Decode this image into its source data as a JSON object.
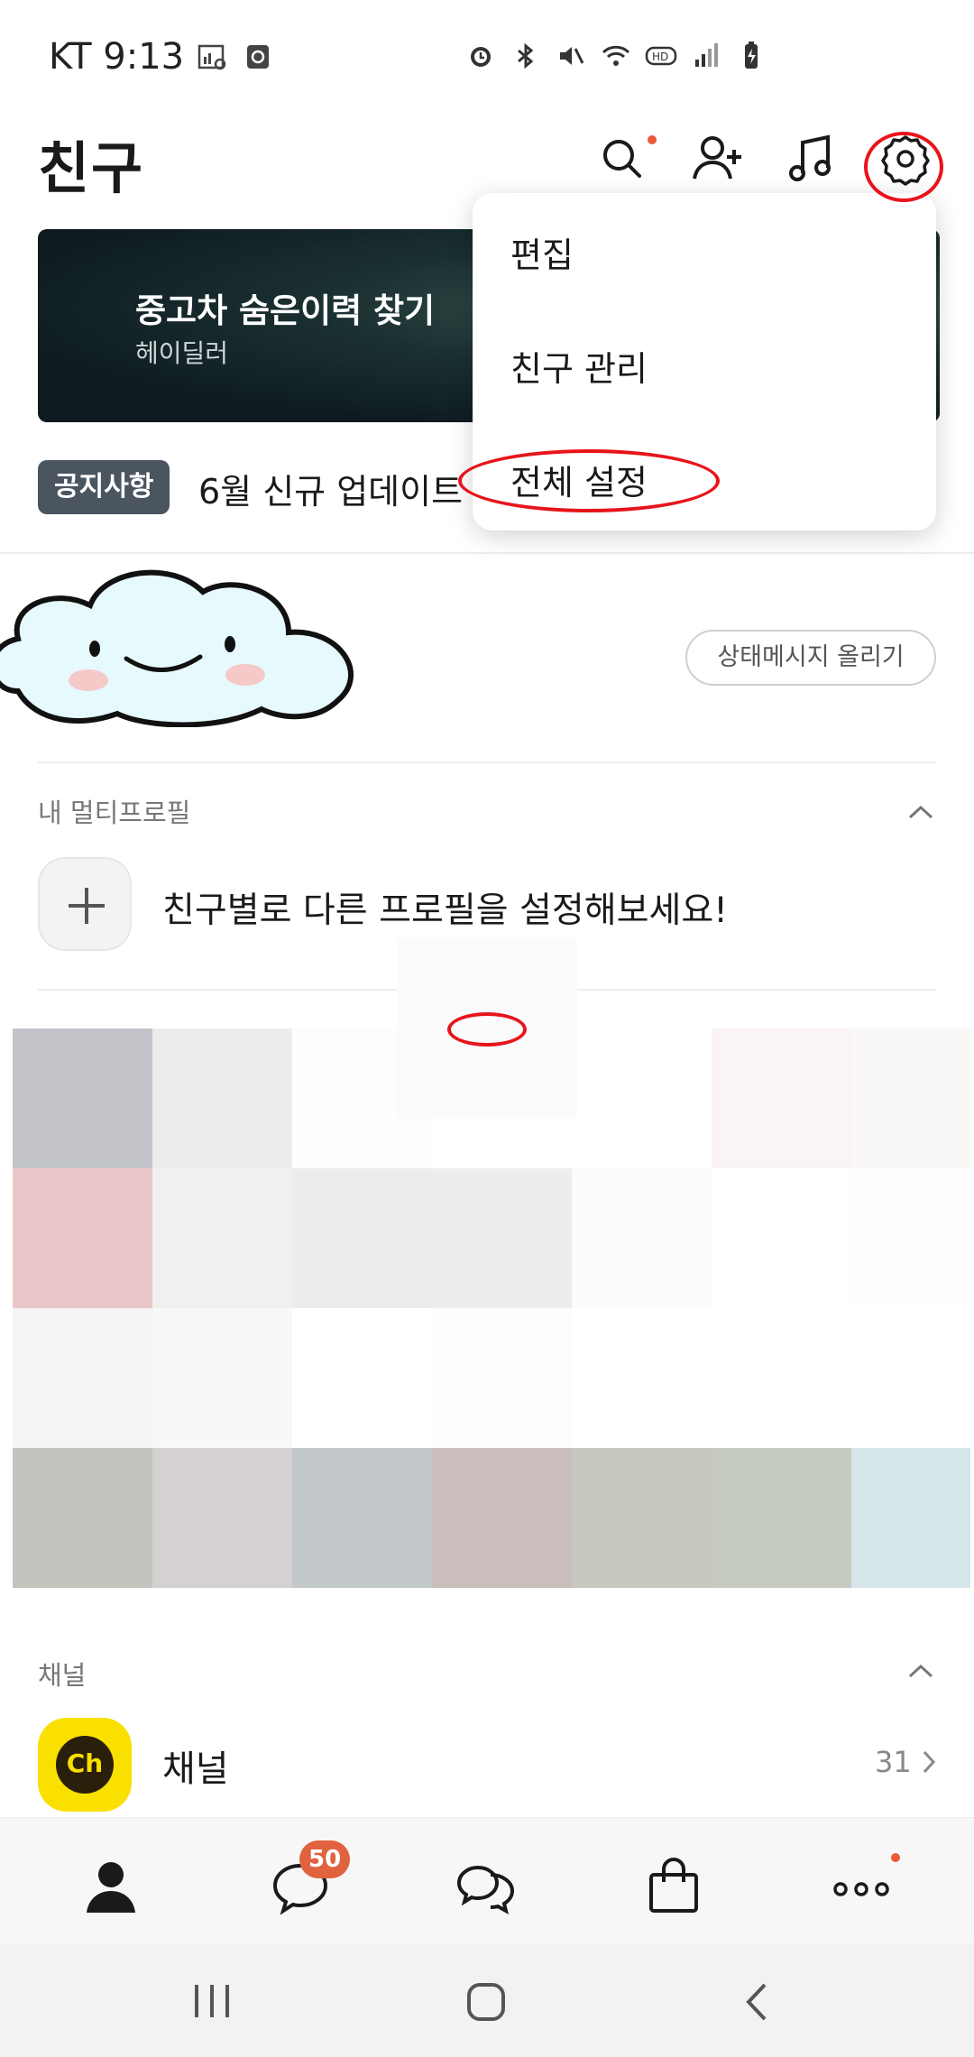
{
  "status_bar": {
    "carrier_time": "KT 9:13"
  },
  "header": {
    "title": "친구",
    "icons": [
      "search-icon",
      "add-friend-icon",
      "music-icon",
      "settings-icon"
    ]
  },
  "banner": {
    "title": "중고차 숨은이력 찾기",
    "subtitle": "헤이딜러"
  },
  "notice": {
    "badge": "공지사항",
    "text": "6월 신규 업데이트"
  },
  "profile": {
    "status_button": "상태메시지 올리기"
  },
  "multi_profile": {
    "section_label": "내 멀티프로필",
    "prompt": "친구별로 다른 프로필을 설정해보세요!"
  },
  "channel": {
    "section_label": "채널",
    "name": "채널",
    "count": "31",
    "logo_text": "Ch"
  },
  "bottom_nav": {
    "chat_badge": "50",
    "items": [
      "friends-icon",
      "chat-icon",
      "openchat-icon",
      "shopping-icon",
      "more-icon"
    ]
  },
  "menu": {
    "items": [
      "편집",
      "친구 관리",
      "전체 설정"
    ]
  },
  "mosaic_colors": [
    [
      "#c3c4c9",
      "#ececec",
      "#fdfdfd",
      "#ffffff",
      "#ffffff",
      "#faf4f4",
      "#faf7f7"
    ],
    [
      "#ebc6c8",
      "#f0f0f0",
      "#ececec",
      "#ededed",
      "#fbfbfb",
      "#ffffff",
      "#fefefe"
    ],
    [
      "#f4f4f4",
      "#f8f8f8",
      "#ffffff",
      "#fefcfd",
      "#ffffff",
      "#ffffff",
      "#ffffff"
    ],
    [
      "#c2c3bd",
      "#d6d1d1",
      "#c3c8cb",
      "#c9bebb",
      "#c6c7bf",
      "#c6cbc1",
      "#d6e5ea"
    ]
  ],
  "colors": {
    "accent_red": "#ea5a3a",
    "kakao_yellow": "#f9e000"
  }
}
